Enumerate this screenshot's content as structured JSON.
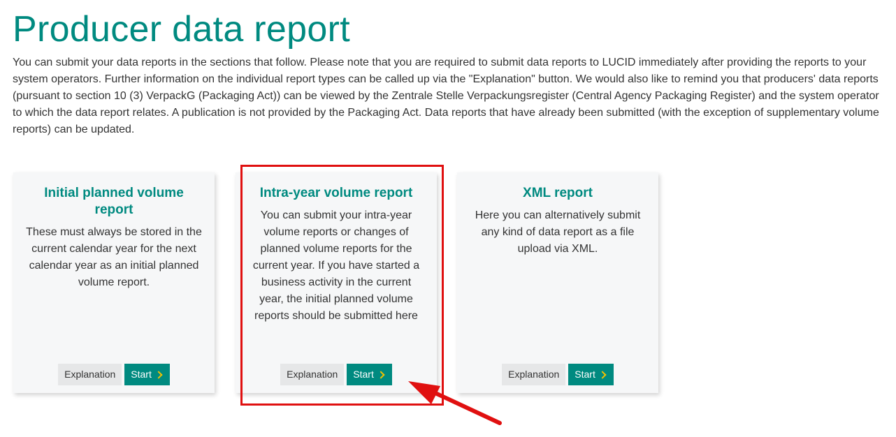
{
  "page": {
    "title": "Producer data report",
    "intro": "You can submit your data reports in the sections that follow. Please note that you are required to submit data reports to LUCID immediately after providing the reports to your system operators. Further information on the individual report types can be called up via the \"Explanation\" button. We would also like to remind you that producers' data reports (pursuant to section 10 (3) VerpackG (Packaging Act)) can be viewed by the Zentrale Stelle Verpackungsregister (Central Agency Packaging Register) and the system operator to which the data report relates. A publication is not provided by the Packaging Act. Data reports that have already been submitted (with the exception of supplementary volume reports) can be updated."
  },
  "cards": [
    {
      "title": "Initial planned volume report",
      "text": "These must always be stored in the current calendar year for the next calendar year as an initial planned volume report.",
      "explanation_label": "Explanation",
      "start_label": "Start"
    },
    {
      "title": "Intra-year volume report",
      "text": "You can submit your intra-year volume reports or changes of planned volume reports for the current year. If you have started a business activity in the current year, the initial planned volume reports should be submitted here",
      "explanation_label": "Explanation",
      "start_label": "Start"
    },
    {
      "title": "XML report",
      "text": "Here you can alternatively submit any kind of data report as a file upload via XML.",
      "explanation_label": "Explanation",
      "start_label": "Start"
    }
  ],
  "colors": {
    "brand": "#008a80",
    "accent_chevron": "#f2c200",
    "annotation": "#e01010"
  },
  "icons": {
    "start_chevron": "chevron-right-icon",
    "annotation_arrow": "arrow-icon"
  }
}
